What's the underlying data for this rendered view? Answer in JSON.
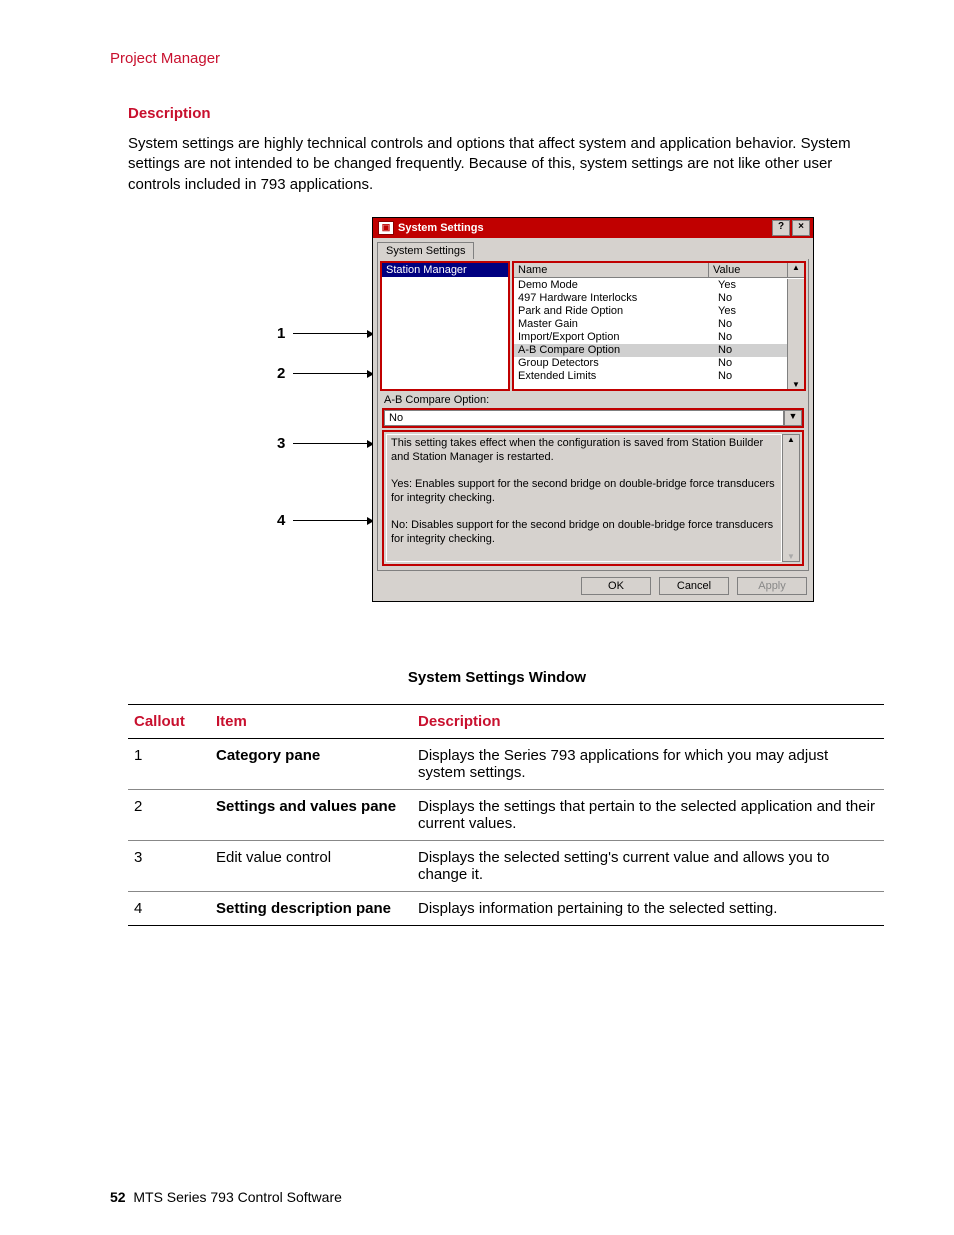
{
  "header": {
    "section": "Project Manager"
  },
  "section": {
    "heading": "Description",
    "body": "System settings are highly technical controls and options that affect system and application behavior. System settings are not intended to be changed frequently. Because of this, system settings are not like other user controls included in 793 applications."
  },
  "callouts": {
    "c1": "1",
    "c2": "2",
    "c3": "3",
    "c4": "4"
  },
  "dialog": {
    "title": "System Settings",
    "help_btn": "?",
    "close_btn": "×",
    "tab_label": "System Settings",
    "category_item": "Station Manager",
    "columns": {
      "name": "Name",
      "value": "Value"
    },
    "rows": {
      "r0": {
        "name": "Demo Mode",
        "value": "Yes"
      },
      "r1": {
        "name": "497 Hardware Interlocks",
        "value": "No"
      },
      "r2": {
        "name": "Park and Ride Option",
        "value": "Yes"
      },
      "r3": {
        "name": "Master Gain",
        "value": "No"
      },
      "r4": {
        "name": "Import/Export Option",
        "value": "No"
      },
      "r5": {
        "name": "A-B Compare Option",
        "value": "No"
      },
      "r6": {
        "name": "Group Detectors",
        "value": "No"
      },
      "r7": {
        "name": "Extended Limits",
        "value": "No"
      }
    },
    "edit_label": "A-B Compare Option:",
    "edit_value": "No",
    "info_p1": "This setting takes effect when the configuration is saved from Station Builder and Station Manager is restarted.",
    "info_p2": "Yes: Enables support for the second bridge on double-bridge force transducers for integrity checking.",
    "info_p3": "No: Disables support for the second bridge on double-bridge force transducers for integrity checking.",
    "buttons": {
      "ok": "OK",
      "cancel": "Cancel",
      "apply": "Apply"
    },
    "scroll_up": "▲",
    "scroll_down": "▼",
    "dropdown_arrow": "▼"
  },
  "figure_caption": "System Settings Window",
  "table": {
    "headers": {
      "callout": "Callout",
      "item": "Item",
      "desc": "Description"
    },
    "rows": {
      "r1": {
        "num": "1",
        "item": "Category pane",
        "desc": "Displays the Series 793 applications for which you may adjust system settings."
      },
      "r2": {
        "num": "2",
        "item": "Settings and values pane",
        "desc": "Displays the settings that pertain to the selected application and their current values."
      },
      "r3": {
        "num": "3",
        "item": "Edit value control",
        "desc": "Displays the selected setting's current value and allows you to change it."
      },
      "r4": {
        "num": "4",
        "item": "Setting description pane",
        "desc": "Displays information pertaining to the selected setting."
      }
    }
  },
  "footer": {
    "page": "52",
    "title": "MTS Series 793 Control Software"
  }
}
